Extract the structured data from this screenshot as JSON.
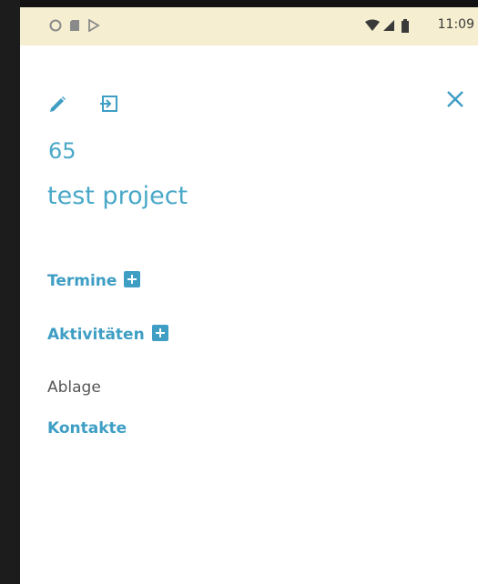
{
  "status_bar": {
    "time": "11:09"
  },
  "header": {
    "edit_icon": "pencil-icon",
    "export_icon": "sign-in-icon",
    "close_icon": "close-icon"
  },
  "project": {
    "number": "65",
    "name": "test project"
  },
  "sections": {
    "termine": "Termine",
    "aktivitaeten": "Aktivitäten",
    "ablage": "Ablage",
    "kontakte": "Kontakte"
  },
  "colors": {
    "accent": "#3e9ec4",
    "status_bar_bg": "#f5eed0"
  }
}
